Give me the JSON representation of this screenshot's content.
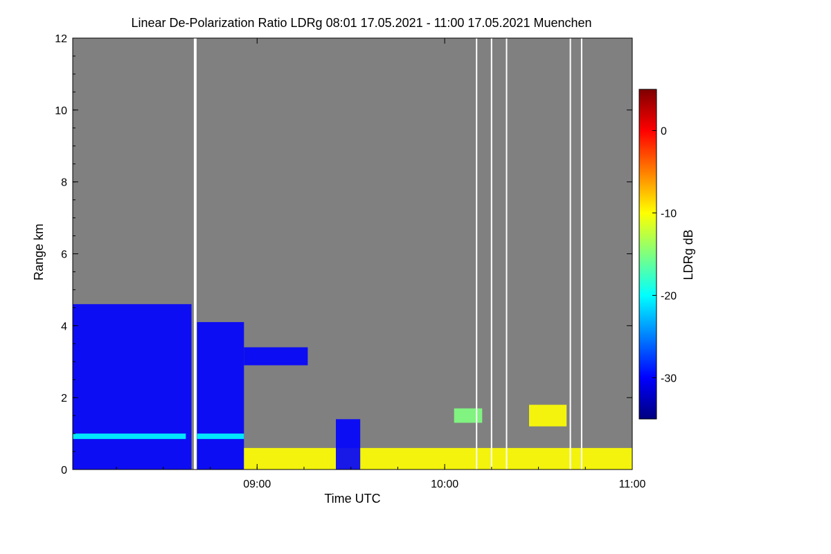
{
  "chart_data": {
    "type": "heatmap",
    "title": "Linear De-Polarization Ratio LDRg   08:01 17.05.2021 - 11:00 17.05.2021 Muenchen",
    "xlabel": "Time UTC",
    "ylabel": "Range km",
    "colorbar_label": "LDRg dB",
    "x_range_hours": [
      8.017,
      11.0
    ],
    "ylim": [
      0,
      12
    ],
    "x_ticks": [
      {
        "label": "09:00",
        "value": 9.0
      },
      {
        "label": "10:00",
        "value": 10.0
      },
      {
        "label": "11:00",
        "value": 11.0
      }
    ],
    "y_ticks": [
      {
        "label": "0",
        "value": 0
      },
      {
        "label": "2",
        "value": 2
      },
      {
        "label": "4",
        "value": 4
      },
      {
        "label": "6",
        "value": 6
      },
      {
        "label": "8",
        "value": 8
      },
      {
        "label": "10",
        "value": 10
      },
      {
        "label": "12",
        "value": 12
      }
    ],
    "colorbar_range": [
      -35,
      5
    ],
    "colorbar_ticks": [
      {
        "label": "0",
        "value": 0
      },
      {
        "label": "-10",
        "value": -10
      },
      {
        "label": "-20",
        "value": -20
      },
      {
        "label": "-30",
        "value": -30
      }
    ],
    "colormap": [
      "#00007f",
      "#0000ff",
      "#007fff",
      "#00ffff",
      "#7fff7f",
      "#ffff00",
      "#ff7f00",
      "#ff0000",
      "#7f0000"
    ],
    "background_color": "#808080",
    "data_gaps_hours": [
      8.67,
      10.17,
      10.25,
      10.33,
      10.67,
      10.73
    ],
    "regions": [
      {
        "t": [
          8.017,
          8.65
        ],
        "z": [
          0,
          4.6
        ],
        "ldr": -32
      },
      {
        "t": [
          8.017,
          8.62
        ],
        "z": [
          0.85,
          1.0
        ],
        "ldr": -22
      },
      {
        "t": [
          8.68,
          8.93
        ],
        "z": [
          0,
          4.1
        ],
        "ldr": -32
      },
      {
        "t": [
          8.68,
          8.93
        ],
        "z": [
          0.85,
          1.0
        ],
        "ldr": -22
      },
      {
        "t": [
          8.93,
          9.27
        ],
        "z": [
          2.9,
          3.4
        ],
        "ldr": -32
      },
      {
        "t": [
          8.93,
          11.0
        ],
        "z": [
          0,
          0.6
        ],
        "ldr": -8
      },
      {
        "t": [
          9.42,
          9.55
        ],
        "z": [
          0,
          1.4
        ],
        "ldr": -32
      },
      {
        "t": [
          10.05,
          10.2
        ],
        "z": [
          1.3,
          1.7
        ],
        "ldr": -15
      },
      {
        "t": [
          10.45,
          10.65
        ],
        "z": [
          1.2,
          1.8
        ],
        "ldr": -12
      }
    ]
  }
}
